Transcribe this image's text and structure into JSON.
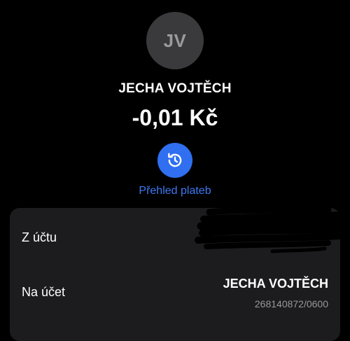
{
  "header": {
    "avatar_initials": "JV",
    "recipient_name": "JECHA VOJTĚCH",
    "amount": "-0,01 Kč"
  },
  "actions": {
    "history_icon": "history-clock-icon",
    "history_label": "Přehled plateb"
  },
  "details": {
    "from_label": "Z účtu",
    "to_label": "Na účet",
    "to_name": "JECHA VOJTĚCH",
    "to_account": "268140872/0600"
  },
  "colors": {
    "background": "#000000",
    "card": "#1c1c1e",
    "accent": "#2f6ff0",
    "accent_text": "#3d7af5",
    "avatar_bg": "#3a3a3c",
    "secondary_text": "#98989d"
  }
}
